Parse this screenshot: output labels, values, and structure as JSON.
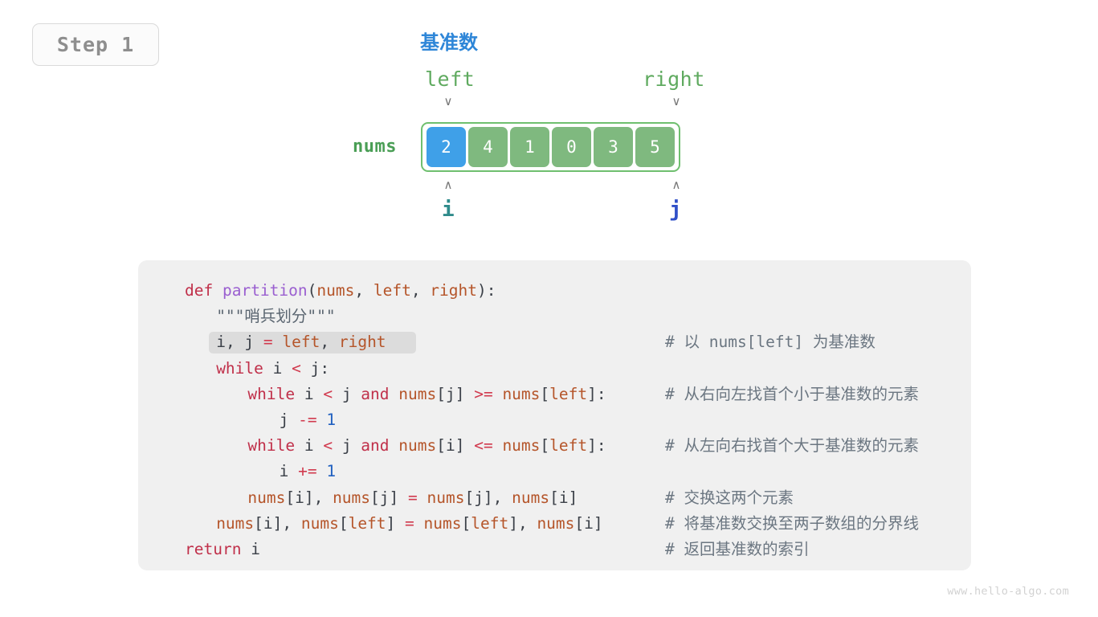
{
  "step_badge": {
    "label": "Step 1"
  },
  "diagram": {
    "pivot_title": "基准数",
    "nums_label": "nums",
    "left_label": "left",
    "right_label": "right",
    "i_label": "i",
    "j_label": "j",
    "down_caret": "∨",
    "up_caret": "∧",
    "cells": [
      {
        "value": "2",
        "state": "pivot"
      },
      {
        "value": "4",
        "state": "normal"
      },
      {
        "value": "1",
        "state": "normal"
      },
      {
        "value": "0",
        "state": "normal"
      },
      {
        "value": "3",
        "state": "normal"
      },
      {
        "value": "5",
        "state": "normal"
      }
    ],
    "colors": {
      "pivot_cell": "#3fa0e8",
      "normal_cell": "#7fb97f",
      "array_border": "#6fbf6f",
      "pivot_title": "#2e86d8",
      "bound_label": "#5faa5f",
      "nums_label": "#4a9e55",
      "i_label": "#2f8b8b",
      "j_label": "#3050c8"
    }
  },
  "code": {
    "language": "python",
    "highlighted_line_index": 2,
    "lines": [
      {
        "indent": 0,
        "tokens": [
          {
            "text": "def ",
            "cls": "t-kw"
          },
          {
            "text": "partition",
            "cls": "t-fn"
          },
          {
            "text": "(",
            "cls": "t-punct"
          },
          {
            "text": "nums",
            "cls": "t-var"
          },
          {
            "text": ", ",
            "cls": "t-punct"
          },
          {
            "text": "left",
            "cls": "t-var"
          },
          {
            "text": ", ",
            "cls": "t-punct"
          },
          {
            "text": "right",
            "cls": "t-var"
          },
          {
            "text": "):",
            "cls": "t-punct"
          }
        ],
        "comment": ""
      },
      {
        "indent": 1,
        "tokens": [
          {
            "text": "\"\"\"哨兵划分\"\"\"",
            "cls": "t-doc"
          }
        ],
        "comment": ""
      },
      {
        "indent": 1,
        "tokens": [
          {
            "text": "i",
            "cls": "t-punct"
          },
          {
            "text": ", ",
            "cls": "t-punct"
          },
          {
            "text": "j ",
            "cls": "t-punct"
          },
          {
            "text": "= ",
            "cls": "t-op"
          },
          {
            "text": "left",
            "cls": "t-var"
          },
          {
            "text": ", ",
            "cls": "t-punct"
          },
          {
            "text": "right",
            "cls": "t-var"
          }
        ],
        "comment": "# 以 nums[left] 为基准数",
        "highlight_width": 258
      },
      {
        "indent": 1,
        "tokens": [
          {
            "text": "while ",
            "cls": "t-kw"
          },
          {
            "text": "i ",
            "cls": "t-punct"
          },
          {
            "text": "< ",
            "cls": "t-op"
          },
          {
            "text": "j:",
            "cls": "t-punct"
          }
        ],
        "comment": ""
      },
      {
        "indent": 2,
        "tokens": [
          {
            "text": "while ",
            "cls": "t-kw"
          },
          {
            "text": "i ",
            "cls": "t-punct"
          },
          {
            "text": "< ",
            "cls": "t-op"
          },
          {
            "text": "j ",
            "cls": "t-punct"
          },
          {
            "text": "and ",
            "cls": "t-kw"
          },
          {
            "text": "nums",
            "cls": "t-var"
          },
          {
            "text": "[j] ",
            "cls": "t-punct"
          },
          {
            "text": ">= ",
            "cls": "t-op"
          },
          {
            "text": "nums",
            "cls": "t-var"
          },
          {
            "text": "[",
            "cls": "t-punct"
          },
          {
            "text": "left",
            "cls": "t-var"
          },
          {
            "text": "]:",
            "cls": "t-punct"
          }
        ],
        "comment": "# 从右向左找首个小于基准数的元素"
      },
      {
        "indent": 3,
        "tokens": [
          {
            "text": "j ",
            "cls": "t-punct"
          },
          {
            "text": "-= ",
            "cls": "t-op"
          },
          {
            "text": "1",
            "cls": "t-num"
          }
        ],
        "comment": ""
      },
      {
        "indent": 2,
        "tokens": [
          {
            "text": "while ",
            "cls": "t-kw"
          },
          {
            "text": "i ",
            "cls": "t-punct"
          },
          {
            "text": "< ",
            "cls": "t-op"
          },
          {
            "text": "j ",
            "cls": "t-punct"
          },
          {
            "text": "and ",
            "cls": "t-kw"
          },
          {
            "text": "nums",
            "cls": "t-var"
          },
          {
            "text": "[i] ",
            "cls": "t-punct"
          },
          {
            "text": "<= ",
            "cls": "t-op"
          },
          {
            "text": "nums",
            "cls": "t-var"
          },
          {
            "text": "[",
            "cls": "t-punct"
          },
          {
            "text": "left",
            "cls": "t-var"
          },
          {
            "text": "]:",
            "cls": "t-punct"
          }
        ],
        "comment": "# 从左向右找首个大于基准数的元素"
      },
      {
        "indent": 3,
        "tokens": [
          {
            "text": "i ",
            "cls": "t-punct"
          },
          {
            "text": "+= ",
            "cls": "t-op"
          },
          {
            "text": "1",
            "cls": "t-num"
          }
        ],
        "comment": ""
      },
      {
        "indent": 2,
        "tokens": [
          {
            "text": "nums",
            "cls": "t-var"
          },
          {
            "text": "[i], ",
            "cls": "t-punct"
          },
          {
            "text": "nums",
            "cls": "t-var"
          },
          {
            "text": "[j] ",
            "cls": "t-punct"
          },
          {
            "text": "= ",
            "cls": "t-op"
          },
          {
            "text": "nums",
            "cls": "t-var"
          },
          {
            "text": "[j], ",
            "cls": "t-punct"
          },
          {
            "text": "nums",
            "cls": "t-var"
          },
          {
            "text": "[i]",
            "cls": "t-punct"
          }
        ],
        "comment": "# 交换这两个元素"
      },
      {
        "indent": 1,
        "tokens": [
          {
            "text": "nums",
            "cls": "t-var"
          },
          {
            "text": "[i], ",
            "cls": "t-punct"
          },
          {
            "text": "nums",
            "cls": "t-var"
          },
          {
            "text": "[",
            "cls": "t-punct"
          },
          {
            "text": "left",
            "cls": "t-var"
          },
          {
            "text": "] ",
            "cls": "t-punct"
          },
          {
            "text": "= ",
            "cls": "t-op"
          },
          {
            "text": "nums",
            "cls": "t-var"
          },
          {
            "text": "[",
            "cls": "t-punct"
          },
          {
            "text": "left",
            "cls": "t-var"
          },
          {
            "text": "], ",
            "cls": "t-punct"
          },
          {
            "text": "nums",
            "cls": "t-var"
          },
          {
            "text": "[i]",
            "cls": "t-punct"
          }
        ],
        "comment": "# 将基准数交换至两子数组的分界线"
      },
      {
        "indent": 0,
        "tokens": [
          {
            "text": "return ",
            "cls": "t-kw"
          },
          {
            "text": "i",
            "cls": "t-punct"
          }
        ],
        "comment": "# 返回基准数的索引"
      }
    ]
  },
  "footer": {
    "watermark": "www.hello-algo.com"
  }
}
